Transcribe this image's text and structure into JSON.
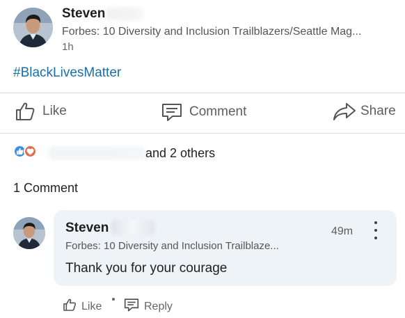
{
  "post": {
    "author_name": "Steven",
    "author_headline": "Forbes: 10 Diversity and Inclusion Trailblazers/Seattle Mag...",
    "timestamp": "1h",
    "hashtag": "#BlackLivesMatter"
  },
  "actions": {
    "like": "Like",
    "comment": "Comment",
    "share": "Share"
  },
  "reactions": {
    "icons": [
      "like-icon",
      "love-icon"
    ],
    "text": "and 2 others"
  },
  "comments_summary": "1 Comment",
  "comment": {
    "author_name": "Steven",
    "author_headline": "Forbes: 10 Diversity and Inclusion Trailblaze...",
    "timestamp": "49m",
    "text": "Thank you for your courage",
    "like_label": "Like",
    "reply_label": "Reply"
  },
  "colors": {
    "hashtag": "#1a6fa6",
    "like_reaction": "#378fe9",
    "love_reaction": "#df704d",
    "comment_bubble": "#eef3f8"
  }
}
